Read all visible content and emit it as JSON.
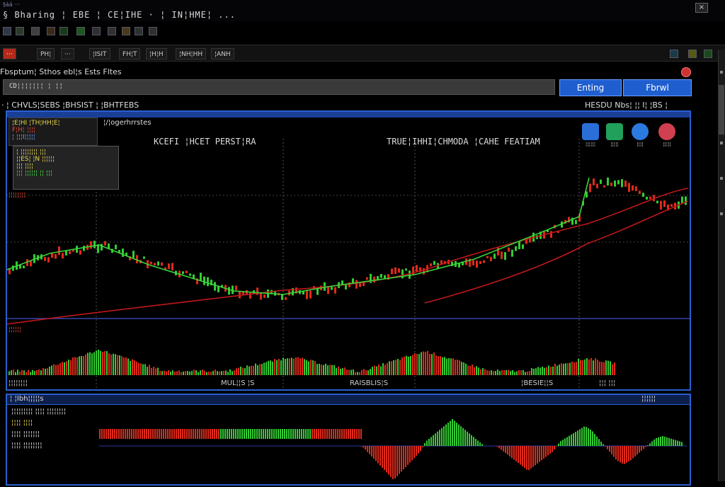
{
  "window": {
    "subtitle": "§áá ···",
    "title": "§ Bharing  ¦ EBE  ¦ CE¦IHE  · ¦ IN¦HME¦ ...",
    "close_label": "×"
  },
  "toolbar2": [
    "···",
    "PH¦",
    "···",
    "¦ISIT",
    "FH¦T",
    "¦H¦H",
    "¦NH¦HH",
    "¦ANH"
  ],
  "order": {
    "label": "Fbsptum¦ Sthos ebl¦s Ests Fltes",
    "input_value": "CD¦¦¦¦¦¦¦ ¦ ¦¦",
    "entry_button": "Enting",
    "final_button": "Fbrwl"
  },
  "symbol_bar": {
    "left": "· ¦ CHVLS¦SEBS  ¦BHSIST ¦  ¦BHTFEBS",
    "right": "HESDU Nbs¦ ¦¦  I¦ ¦BS ¦"
  },
  "main_chart": {
    "info_lines": [
      "¦E¦HI ¦TH¦HH¦E¦",
      "F¦H¦ ¦¦¦¦",
      "¦ ¦¦¦I¦¦¦¦¦"
    ],
    "panel_title": "¦/¦ogerhrrstes",
    "info2_lines": [
      "¦ ¦¦¦¦¦¦¦¦  ¦¦¦",
      "¦¦ES¦ ¦N ¦¦¦¦¦¦",
      "¦¦¦ ¦¦¦¦",
      "¦¦¦ ¦¦¦¦¦¦ ¦¦  ¦¦¦"
    ],
    "red_label": "¦¦¦¦¦¦¦¦",
    "label_left": "KCEFI ¦HCET PERST¦RA",
    "label_center": "TRUE¦IHHI¦CHMODA ¦CAHE FEATIAM",
    "sub_red_label": "¦¦¦¦¦¦",
    "bottom_labels": [
      "¦¦¦¦¦¦¦¦",
      "MUL¦¦S ¦S",
      "RAISBLIS¦S",
      "¦BESIE¦¦S",
      "¦¦¦ ¦¦¦"
    ],
    "icons": [
      {
        "name": "news-icon",
        "label": "¦¦¦¦¦¦",
        "color": "#2a6fd8"
      },
      {
        "name": "calendar-icon",
        "label": "¦¦¦¦¦",
        "color": "#20a05a"
      },
      {
        "name": "globe-icon",
        "label": "¦¦¦¦",
        "color": "#2a7ae0"
      },
      {
        "name": "alert-icon",
        "label": "¦¦¦¦¦",
        "color": "#d04050"
      }
    ]
  },
  "oscillator": {
    "title": "¦ ¦Ibh¦¦¦¦¦s",
    "right_label": "¦¦¦¦¦¦",
    "legend": [
      "¦¦¦¦¦¦¦¦¦ ¦¦¦¦ ¦¦¦¦¦¦¦¦",
      "¦¦¦¦  ¦¦¦¦",
      "¦¦¦¦ ¦¦¦¦¦¦¦",
      "¦¦¦¦ ¦¦¦¦¦¦¦¦"
    ]
  },
  "colors": {
    "panel_border": "#2a5fd0",
    "bull": "#33cc33",
    "bear": "#e02a1a",
    "ma": "#c0181a",
    "button": "#1f5ecf"
  }
}
